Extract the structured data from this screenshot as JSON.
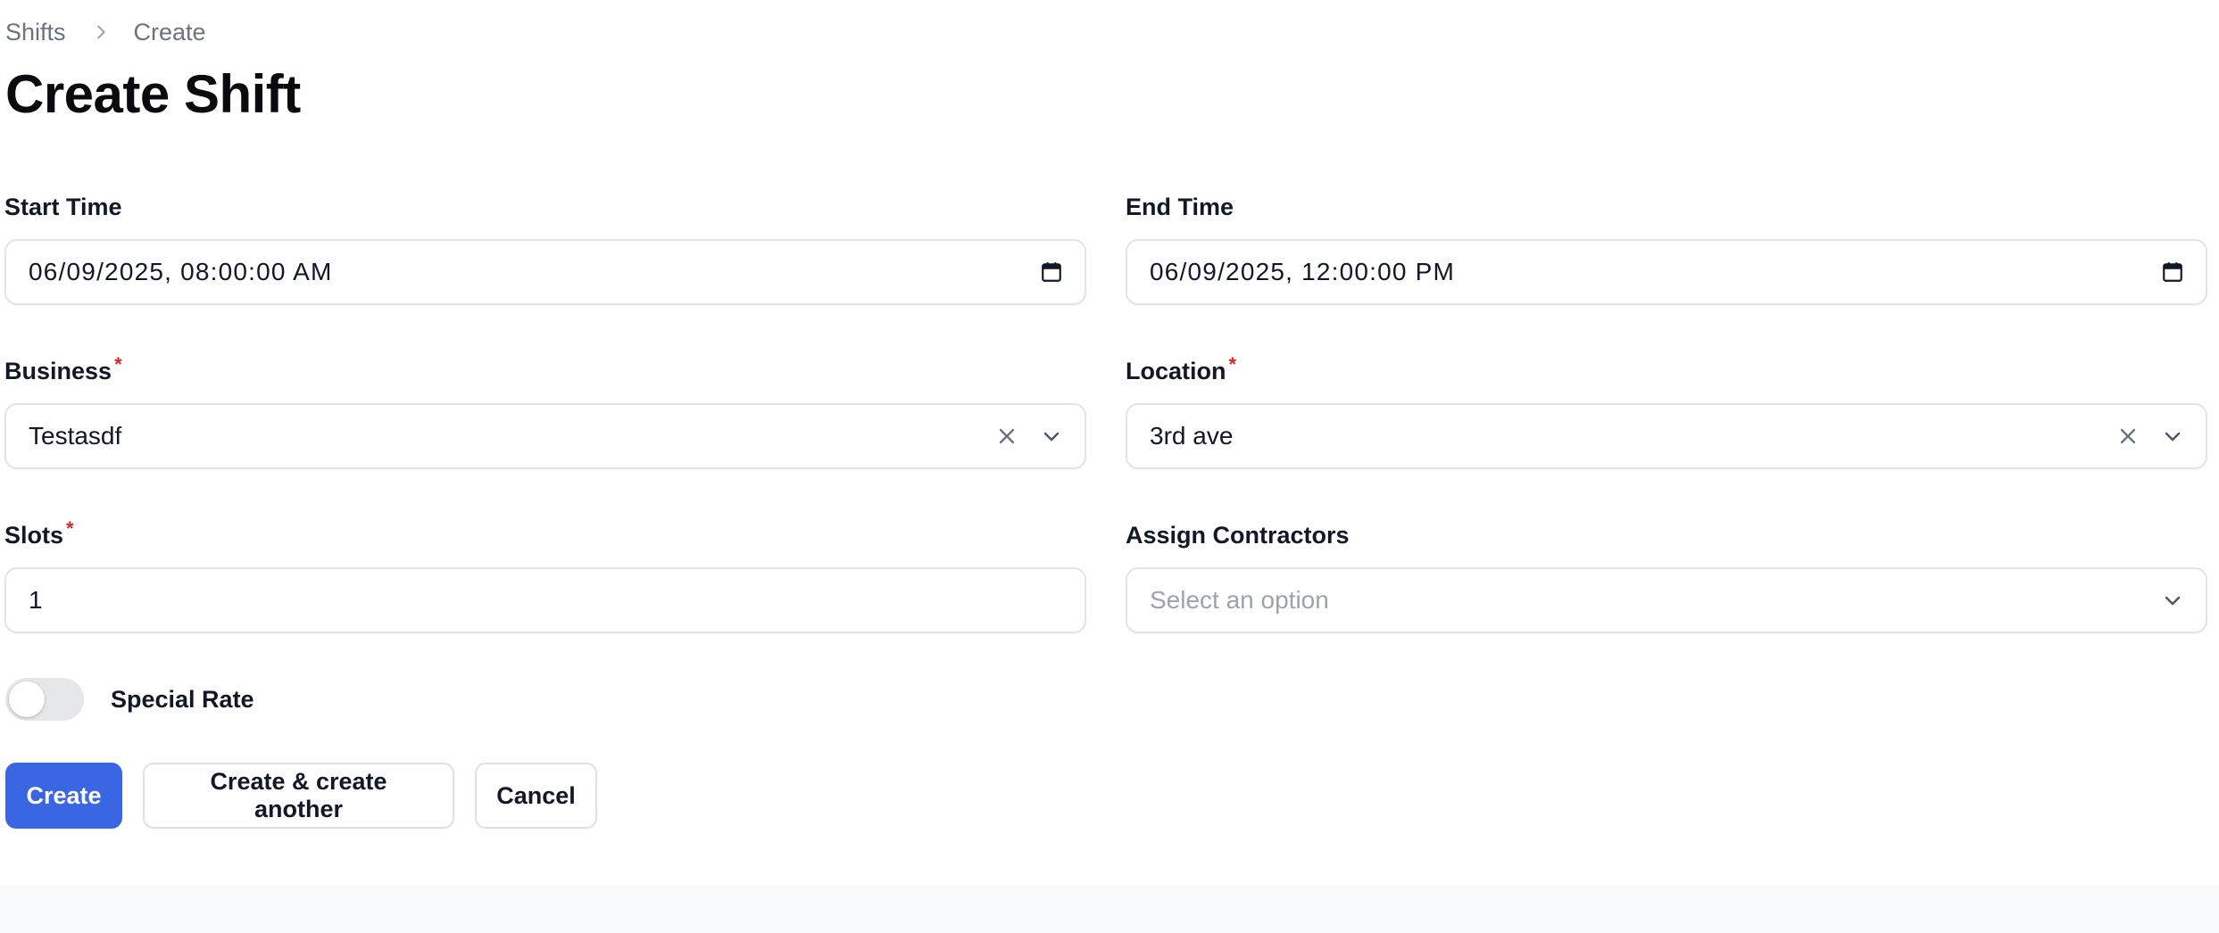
{
  "breadcrumb": {
    "items": [
      "Shifts",
      "Create"
    ]
  },
  "page": {
    "title": "Create Shift"
  },
  "form": {
    "start_time": {
      "label": "Start Time",
      "value": "06/09/2025, 08:00:00 AM"
    },
    "end_time": {
      "label": "End Time",
      "value": "06/09/2025, 12:00:00 PM"
    },
    "business": {
      "label": "Business",
      "required_mark": "*",
      "value": "Testasdf"
    },
    "location": {
      "label": "Location",
      "required_mark": "*",
      "value": "3rd ave"
    },
    "slots": {
      "label": "Slots",
      "required_mark": "*",
      "value": "1"
    },
    "assign_contractors": {
      "label": "Assign Contractors",
      "placeholder": "Select an option"
    },
    "special_rate": {
      "label": "Special Rate",
      "enabled": false
    }
  },
  "actions": {
    "create": "Create",
    "create_another": "Create & create another",
    "cancel": "Cancel"
  },
  "colors": {
    "primary": "#3b66e3",
    "required": "#dc2626",
    "border": "#e2e4e9",
    "muted_text": "#6b7280",
    "placeholder": "#9ca3af",
    "footer_bg": "#f9fafb"
  },
  "icons": {
    "breadcrumb_separator": "chevron-right-icon",
    "calendar": "calendar-icon",
    "clear": "close-icon",
    "dropdown": "chevron-down-icon"
  }
}
